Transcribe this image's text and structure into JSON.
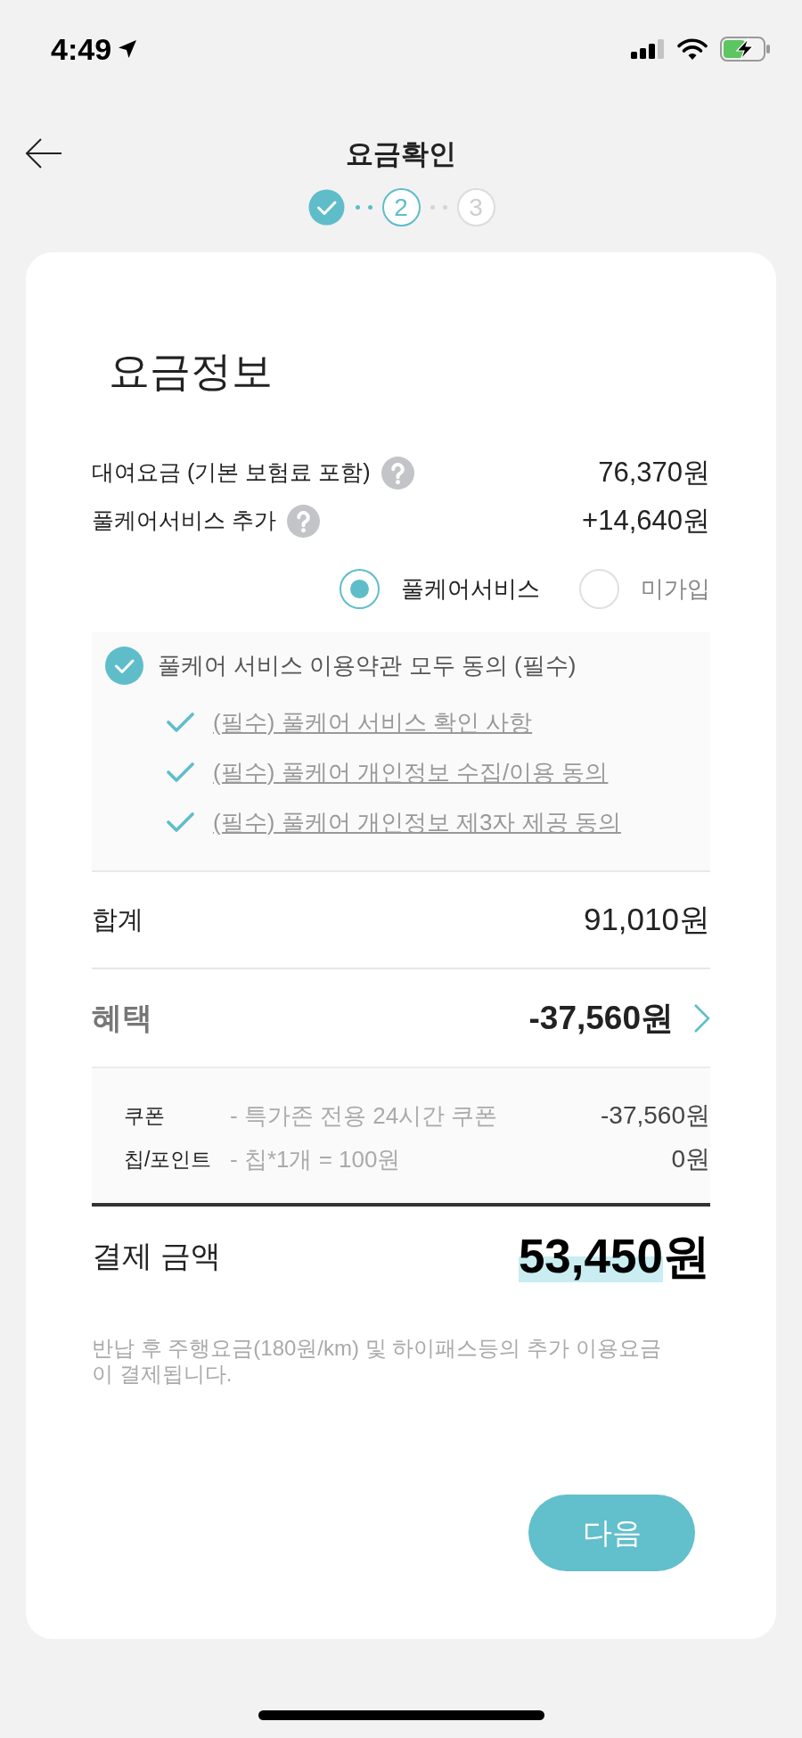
{
  "status_bar": {
    "time": "4:49"
  },
  "header": {
    "title": "요금확인"
  },
  "steps": [
    {
      "completed": true,
      "selected": false
    },
    {
      "label": "2",
      "completed": false,
      "selected": true
    },
    {
      "label": "3",
      "completed": false,
      "selected": false
    }
  ],
  "card": {
    "title": "요금정보",
    "fees": [
      {
        "label": "대여요금 (기본 보험료 포함)",
        "help": true,
        "value": "76,370원"
      },
      {
        "label": "풀케어서비스 추가",
        "help": true,
        "value": "+14,640원"
      }
    ],
    "plan_options": [
      {
        "label": "풀케어서비스",
        "selected": true
      },
      {
        "label": "미가입",
        "selected": false
      }
    ],
    "agreement": {
      "label": "풀케어 서비스 이용약관 모두 동의 (필수)",
      "checked": true,
      "items": [
        {
          "label": "(필수) 풀케어 서비스 확인 사항",
          "checked": true
        },
        {
          "label": "(필수) 풀케어 개인정보 수집/이용 동의",
          "checked": true
        },
        {
          "label": "(필수) 풀케어 개인정보 제3자 제공 동의",
          "checked": true
        }
      ]
    },
    "total": {
      "label": "합계",
      "value": "91,010원"
    },
    "benefit": {
      "label": "혜택",
      "value": "-37,560원",
      "details": [
        {
          "label": "쿠폰",
          "description": "- 특가존 전용 24시간 쿠폰",
          "value": "-37,560원"
        },
        {
          "label": "칩/포인트",
          "description": "- 칩*1개 = 100원",
          "value": "0원"
        }
      ]
    },
    "payment": {
      "label": "결제 금액",
      "amount": "53,450",
      "currency": "원"
    },
    "note": "반납 후 주행요금(180원/km) 및 하이패스등의 추가 이용요금이 결제됩니다.",
    "next_button": "다음"
  }
}
